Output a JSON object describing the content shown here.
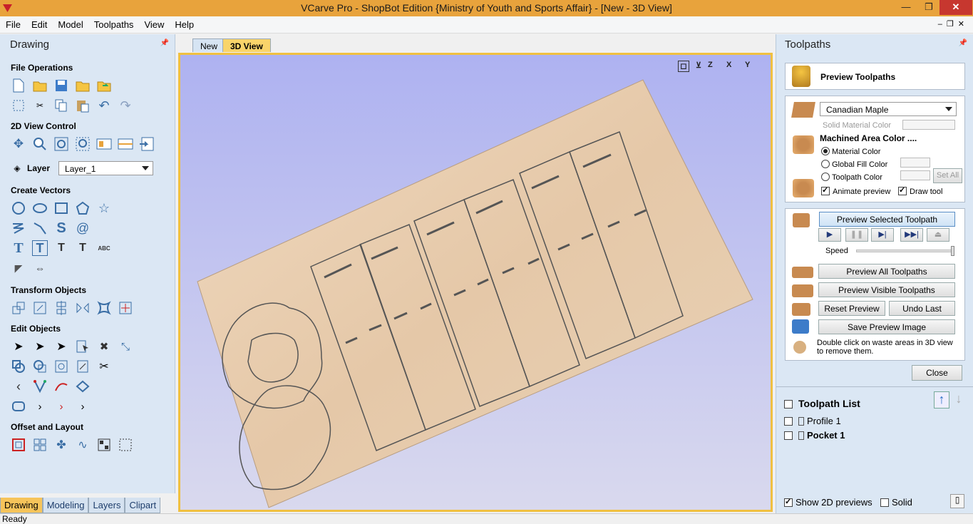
{
  "window": {
    "title": "VCarve Pro - ShopBot Edition {Ministry of Youth and Sports Affair} - [New - 3D View]",
    "min": "—",
    "max": "❐",
    "close": "✕"
  },
  "menu": [
    "File",
    "Edit",
    "Model",
    "Toolpaths",
    "View",
    "Help"
  ],
  "left_panel": {
    "title": "Drawing",
    "sections": {
      "file_ops": "File Operations",
      "view2d": "2D View Control",
      "create_vectors": "Create Vectors",
      "transform": "Transform Objects",
      "edit": "Edit Objects",
      "offset": "Offset and Layout"
    },
    "layer_label": "Layer",
    "layer_value": "Layer_1",
    "tabs": [
      "Drawing",
      "Modeling",
      "Layers",
      "Clipart"
    ]
  },
  "doc_tabs": [
    "New",
    "3D View"
  ],
  "view_icons": [
    "fit",
    "iso",
    "Z",
    "X",
    "Y"
  ],
  "right_panel": {
    "title": "Toolpaths",
    "header": "Preview Toolpaths",
    "material": "Canadian Maple",
    "solid_color_label": "Solid Material Color",
    "machined_label": "Machined Area Color ....",
    "radio": [
      "Material Color",
      "Global Fill Color",
      "Toolpath Color"
    ],
    "set_all": "Set All",
    "animate": "Animate preview",
    "draw_tool": "Draw tool",
    "preview_selected": "Preview Selected Toolpath",
    "speed": "Speed",
    "preview_all": "Preview All Toolpaths",
    "preview_visible": "Preview Visible Toolpaths",
    "reset": "Reset Preview",
    "undo": "Undo Last",
    "save": "Save Preview Image",
    "hint": "Double click on waste areas in 3D view to remove them.",
    "close": "Close",
    "list_title": "Toolpath List",
    "toolpaths": [
      "Profile 1",
      "Pocket 1"
    ],
    "show2d": "Show 2D previews",
    "solid": "Solid"
  },
  "status": "Ready",
  "colors": {
    "title": "#e8a33c",
    "panel": "#dbe7f4",
    "wood": "#e8cfb3",
    "accent": "#f6c45a"
  }
}
